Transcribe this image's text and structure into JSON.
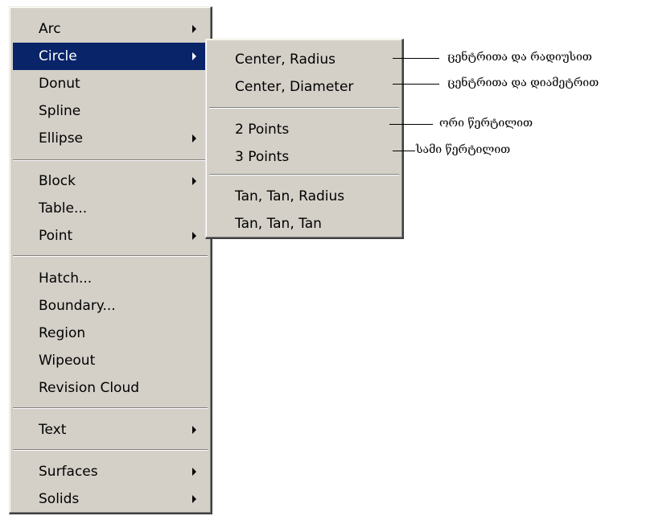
{
  "main_menu": {
    "items": [
      {
        "label": "Arc",
        "submenu": true
      },
      {
        "label": "Circle",
        "submenu": true,
        "selected": true
      },
      {
        "label": "Donut",
        "submenu": false
      },
      {
        "label": "Spline",
        "submenu": false
      },
      {
        "label": "Ellipse",
        "submenu": true
      },
      {
        "label": "Block",
        "submenu": true
      },
      {
        "label": "Table...",
        "submenu": false
      },
      {
        "label": "Point",
        "submenu": true
      },
      {
        "label": "Hatch...",
        "submenu": false
      },
      {
        "label": "Boundary...",
        "submenu": false
      },
      {
        "label": "Region",
        "submenu": false
      },
      {
        "label": "Wipeout",
        "submenu": false
      },
      {
        "label": "Revision Cloud",
        "submenu": false
      },
      {
        "label": "Text",
        "submenu": true
      },
      {
        "label": "Surfaces",
        "submenu": true
      },
      {
        "label": "Solids",
        "submenu": true
      }
    ]
  },
  "circle_submenu": {
    "items": [
      {
        "label": "Center, Radius"
      },
      {
        "label": "Center, Diameter"
      },
      {
        "label": "2 Points"
      },
      {
        "label": "3 Points"
      },
      {
        "label": "Tan, Tan, Radius"
      },
      {
        "label": "Tan, Tan, Tan"
      }
    ]
  },
  "annotations": [
    {
      "text": "ცენტრითა და რადიუსით"
    },
    {
      "text": "ცენტრითა და დიამეტრით"
    },
    {
      "text": "ორი წერტილით"
    },
    {
      "text": "სამი წერტილით"
    }
  ],
  "colors": {
    "menu_bg": "#d4d0c8",
    "highlight": "#0a246a",
    "highlight_text": "#ffffff"
  }
}
